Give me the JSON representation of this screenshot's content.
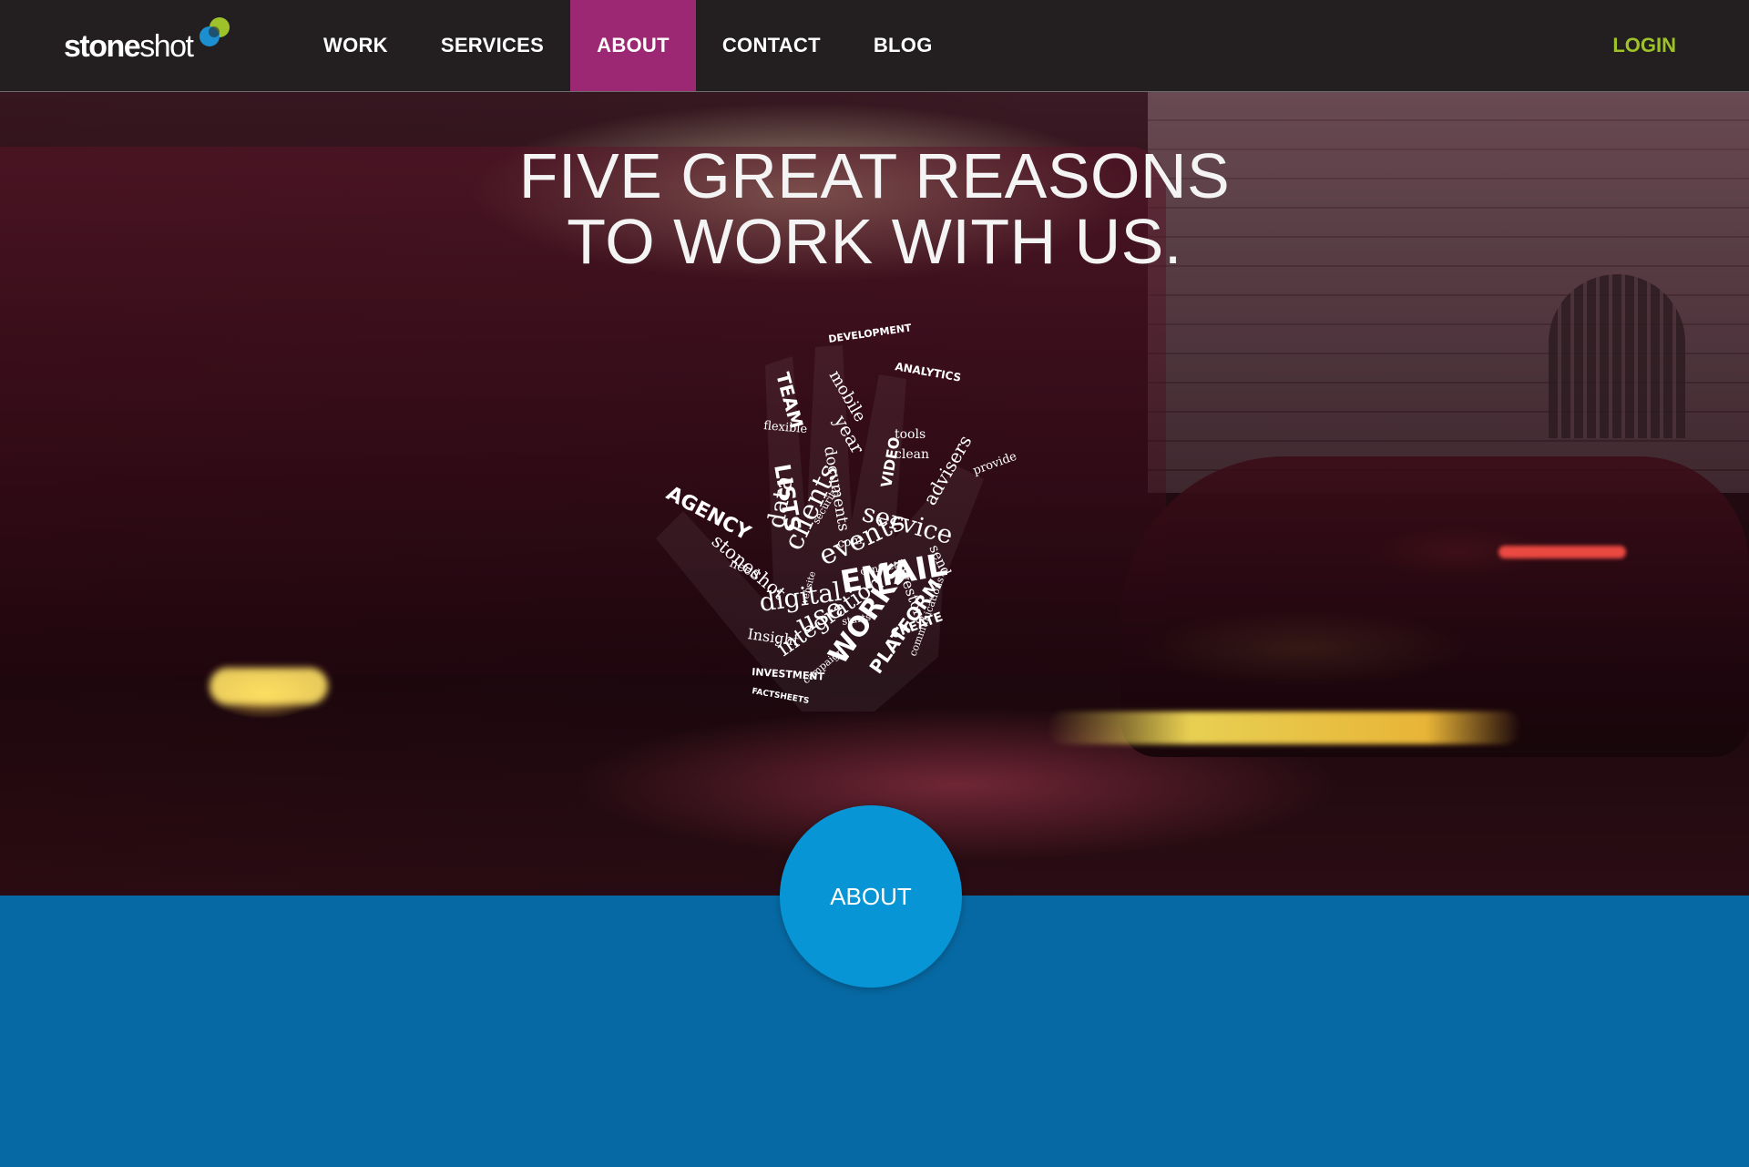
{
  "brand": {
    "logo_bold": "stone",
    "logo_light": "shot",
    "logo_colors": {
      "green": "#9ec22a",
      "blue": "#1c8fd0"
    }
  },
  "nav": {
    "items": [
      {
        "label": "WORK"
      },
      {
        "label": "SERVICES"
      },
      {
        "label": "ABOUT",
        "active": true
      },
      {
        "label": "CONTACT"
      },
      {
        "label": "BLOG"
      }
    ],
    "login_label": "LOGIN"
  },
  "hero": {
    "title_line1": "FIVE GREAT REASONS",
    "title_line2": "TO WORK WITH US.",
    "hand_words": [
      "AGENCY",
      "stoneshot",
      "digital",
      "Insight",
      "integration",
      "WORKS",
      "PLATFORM",
      "INVESTMENT",
      "campaign",
      "EMAIL",
      "use",
      "events",
      "clients",
      "data",
      "LISTS",
      "TEAM",
      "flexible",
      "service",
      "investors",
      "send",
      "CREATE",
      "advisers",
      "provide",
      "VIDEO",
      "documents",
      "year",
      "mobile",
      "DEVELOPMENT",
      "ANALYTICS",
      "tools",
      "clean",
      "need",
      "communications",
      "contact",
      "com",
      "security",
      "starts",
      "FACTSHEETS",
      "website"
    ]
  },
  "about": {
    "circle_label": "ABOUT"
  },
  "colors": {
    "nav_bg": "#231f20",
    "active_tab": "#9c2773",
    "login": "#9ec22a",
    "band": "#0769a3",
    "circle": "#0795d6"
  }
}
